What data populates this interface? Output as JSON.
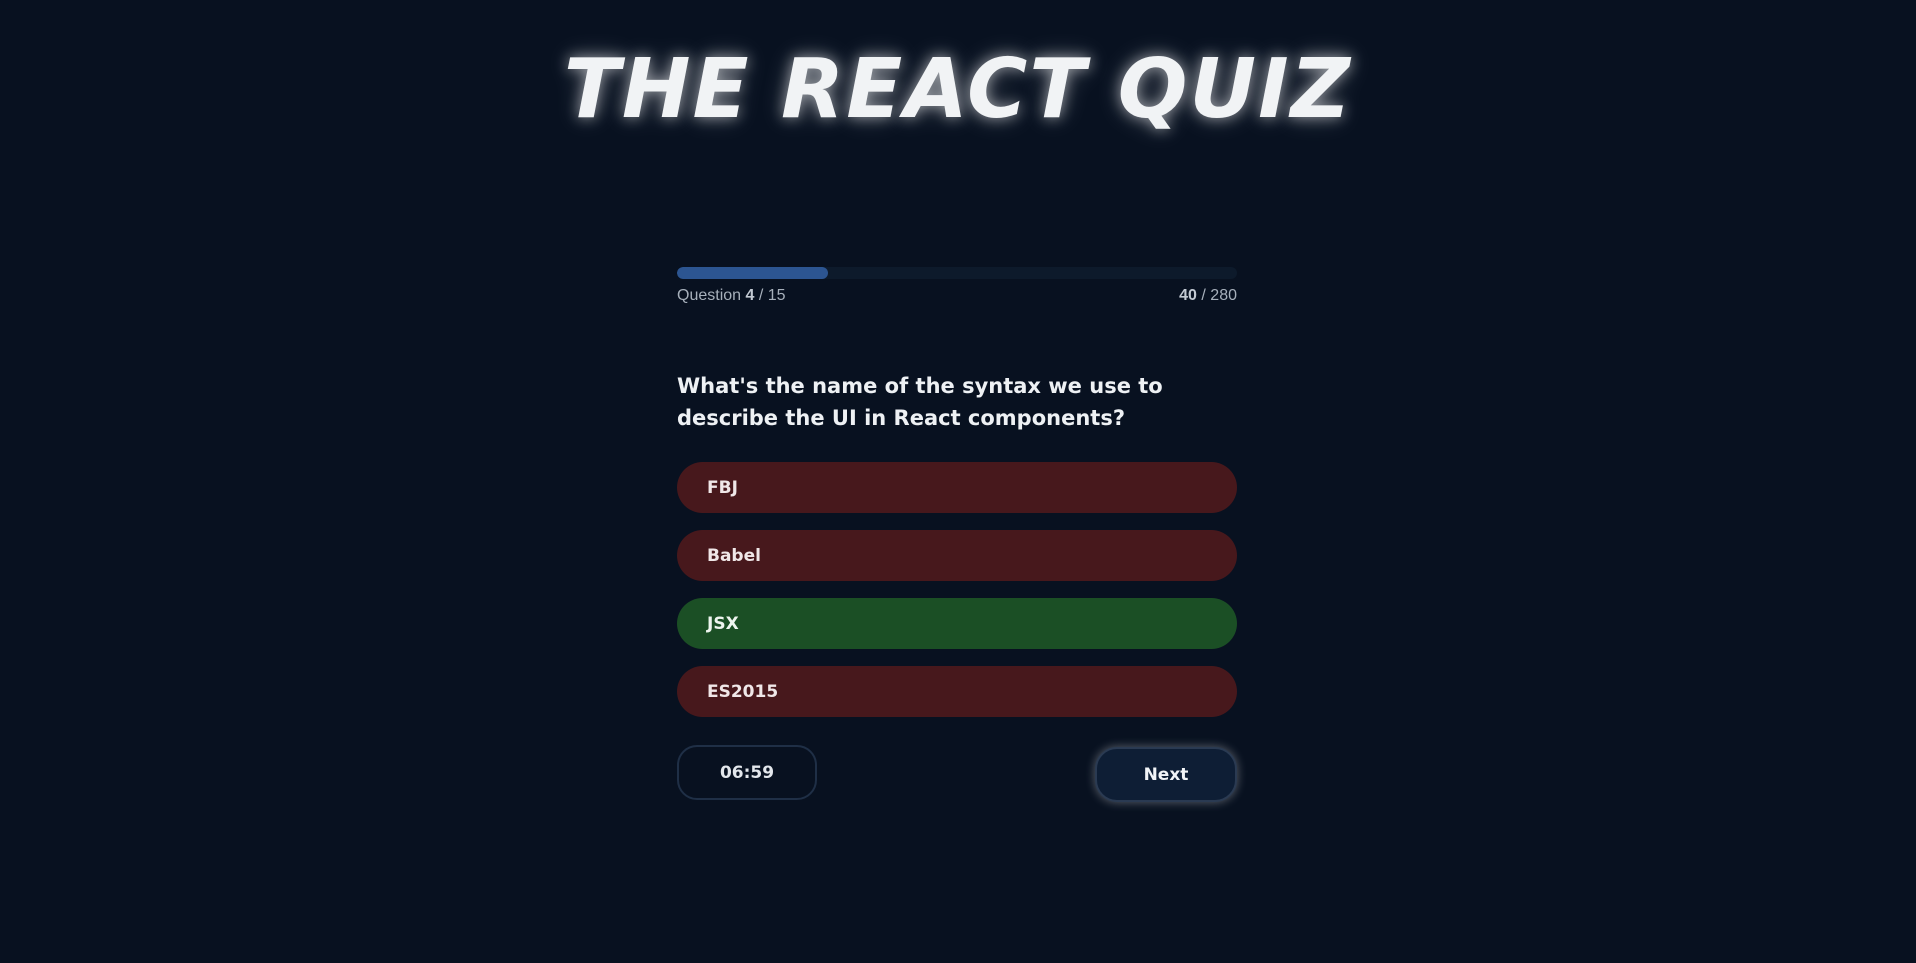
{
  "header": {
    "title": "THE REACT QUIZ"
  },
  "progress": {
    "question_label": "Question",
    "current_question": "4",
    "total_questions": "/ 15",
    "points": "40",
    "max_points": "/ 280",
    "fraction_complete": 0.27
  },
  "question": {
    "text": "What's the name of the syntax we use to describe the UI in React components?"
  },
  "options": [
    {
      "label": "FBJ",
      "state": "wrong"
    },
    {
      "label": "Babel",
      "state": "wrong"
    },
    {
      "label": "JSX",
      "state": "correct"
    },
    {
      "label": "ES2015",
      "state": "wrong"
    }
  ],
  "footer": {
    "timer": "06:59",
    "next_label": "Next"
  },
  "colors": {
    "background": "#081120",
    "progress_fill": "#2c5591",
    "wrong_option": "#47181c",
    "correct_option": "#1b4f25"
  }
}
